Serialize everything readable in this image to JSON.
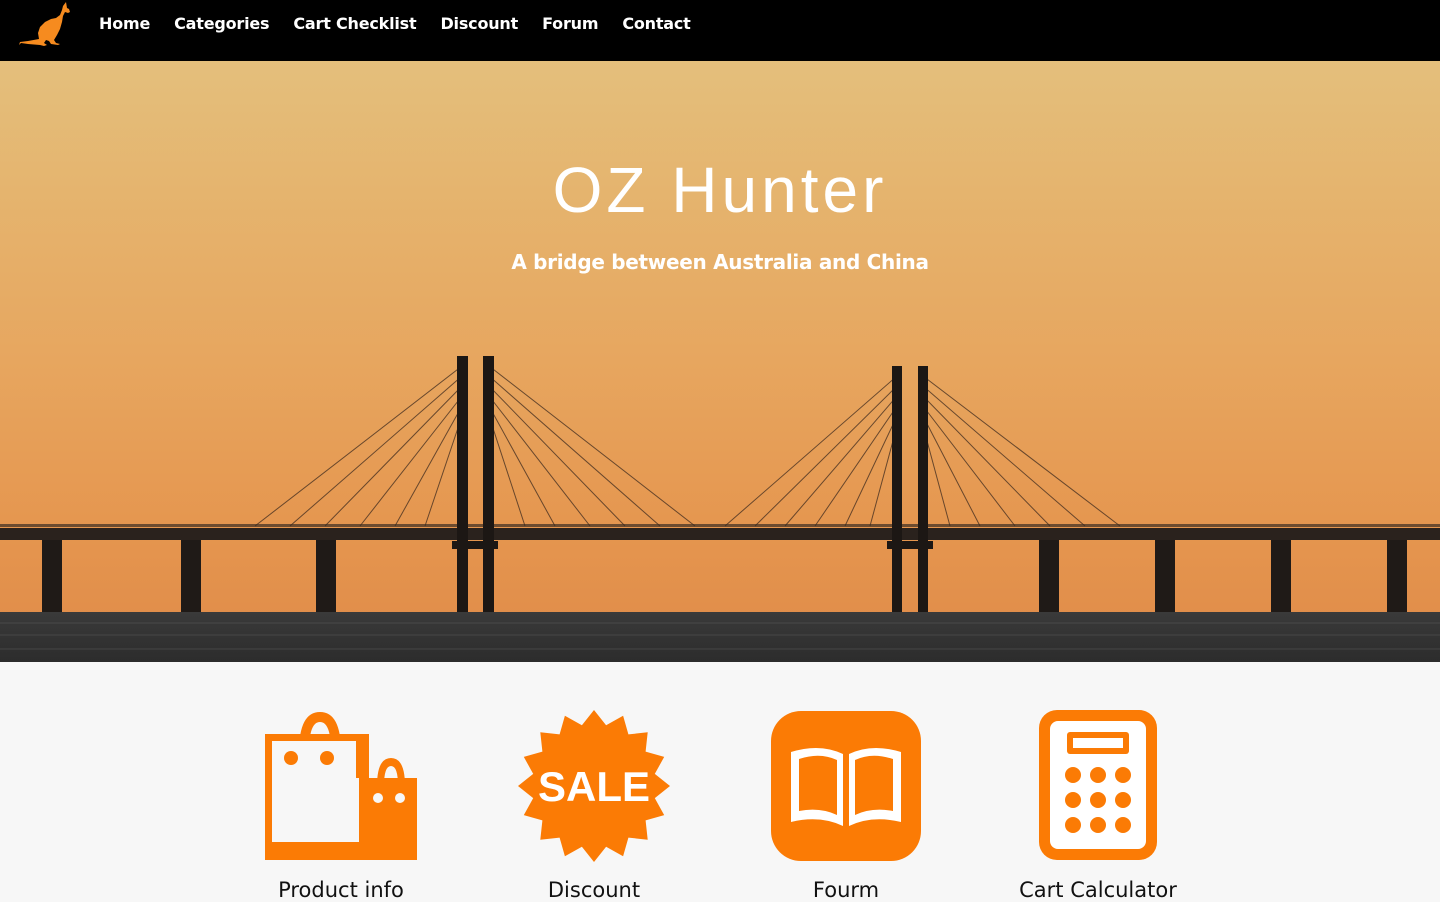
{
  "nav": {
    "logo_icon": "kangaroo-icon",
    "items": [
      {
        "label": "Home"
      },
      {
        "label": "Categories"
      },
      {
        "label": "Cart Checklist"
      },
      {
        "label": "Discount"
      },
      {
        "label": "Forum"
      },
      {
        "label": "Contact"
      }
    ]
  },
  "hero": {
    "title": "OZ Hunter",
    "subtitle": "A bridge between Australia and China",
    "background": "bridge-sunset-image"
  },
  "features": [
    {
      "label": "Product info",
      "icon": "shopping-bags-icon"
    },
    {
      "label": "Discount",
      "icon": "sale-badge-icon",
      "icon_text": "SALE"
    },
    {
      "label": "Fourm",
      "icon": "open-book-icon"
    },
    {
      "label": "Cart Calculator",
      "icon": "calculator-icon"
    }
  ],
  "colors": {
    "accent": "#fb7b05",
    "nav_background": "#000000",
    "text_on_dark": "#ffffff",
    "features_background": "#f7f7f7"
  }
}
